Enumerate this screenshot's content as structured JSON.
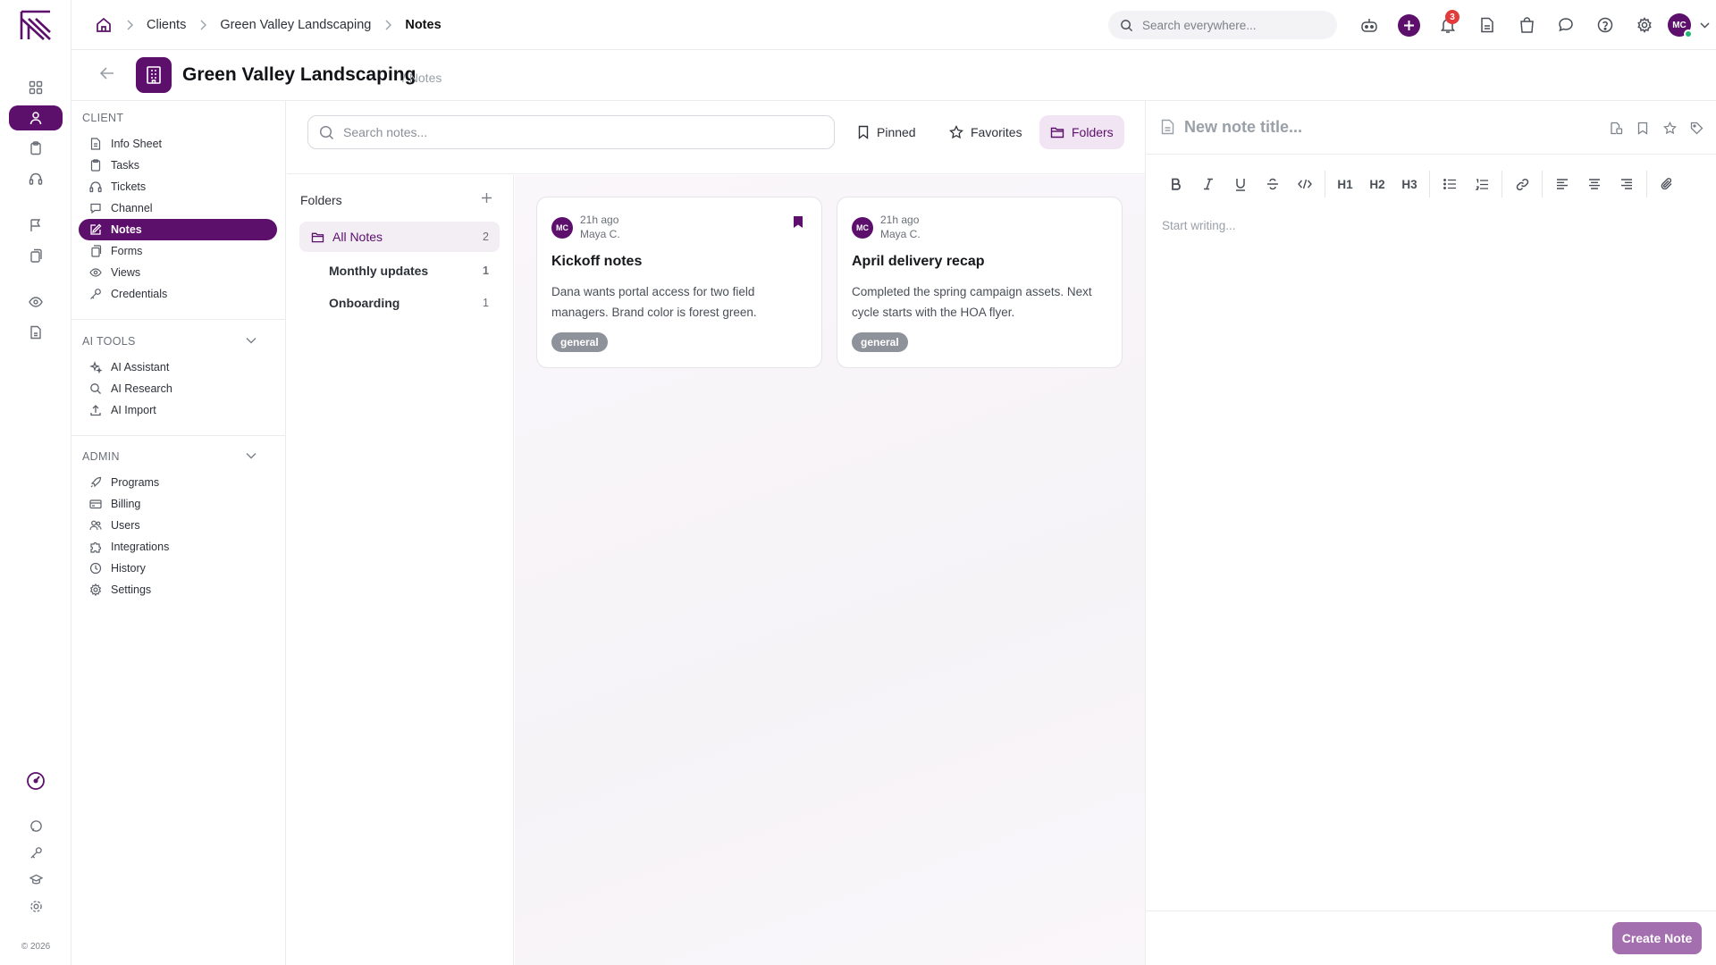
{
  "breadcrumbs": [
    "Clients",
    "Green Valley Landscaping",
    "Notes"
  ],
  "global_search": {
    "placeholder": "Search everywhere..."
  },
  "notifications": {
    "count": "3"
  },
  "user": {
    "initials": "MC"
  },
  "page": {
    "title": "Green Valley Landscaping",
    "subtitle": "/ Notes"
  },
  "nav": {
    "client": {
      "title": "CLIENT",
      "items": [
        {
          "label": "Info Sheet",
          "icon": "info-sheet-icon"
        },
        {
          "label": "Tasks",
          "icon": "clipboard-icon"
        },
        {
          "label": "Tickets",
          "icon": "headset-icon"
        },
        {
          "label": "Channel",
          "icon": "chat-icon"
        },
        {
          "label": "Notes",
          "icon": "edit-icon",
          "active": true
        },
        {
          "label": "Forms",
          "icon": "forms-icon"
        },
        {
          "label": "Views",
          "icon": "eye-icon"
        },
        {
          "label": "Credentials",
          "icon": "key-icon"
        }
      ]
    },
    "ai_tools": {
      "title": "AI TOOLS",
      "items": [
        {
          "label": "AI Assistant",
          "icon": "sparkle-icon"
        },
        {
          "label": "AI Research",
          "icon": "search-icon"
        },
        {
          "label": "AI Import",
          "icon": "upload-icon"
        }
      ]
    },
    "admin": {
      "title": "ADMIN",
      "items": [
        {
          "label": "Programs",
          "icon": "rocket-icon"
        },
        {
          "label": "Billing",
          "icon": "credit-card-icon"
        },
        {
          "label": "Users",
          "icon": "users-icon"
        },
        {
          "label": "Integrations",
          "icon": "puzzle-icon"
        },
        {
          "label": "History",
          "icon": "clock-icon"
        },
        {
          "label": "Settings",
          "icon": "gear-icon"
        }
      ]
    }
  },
  "notes_toolbar": {
    "search_placeholder": "Search notes...",
    "pinned_label": "Pinned",
    "favorites_label": "Favorites",
    "folders_label": "Folders"
  },
  "folders": {
    "title": "Folders",
    "items": [
      {
        "label": "All Notes",
        "count": "2",
        "active": true
      },
      {
        "label": "Monthly updates",
        "count": "1"
      },
      {
        "label": "Onboarding",
        "count": "1"
      }
    ]
  },
  "notes": [
    {
      "avatar": "MC",
      "time": "21h ago",
      "author": "Maya C.",
      "title": "Kickoff notes",
      "body": "Dana wants portal access for two field managers. Brand color is forest green.",
      "tag": "general",
      "pinned": true
    },
    {
      "avatar": "MC",
      "time": "21h ago",
      "author": "Maya C.",
      "title": "April delivery recap",
      "body": "Completed the spring campaign assets. Next cycle starts with the HOA flyer.",
      "tag": "general",
      "pinned": false
    }
  ],
  "editor": {
    "title_placeholder": "New note title...",
    "body_placeholder": "Start writing...",
    "format_labels": {
      "h1": "H1",
      "h2": "H2",
      "h3": "H3"
    },
    "create_label": "Create Note"
  },
  "footer": {
    "copyright": "© 2026"
  },
  "colors": {
    "brand": "#5c0f6b",
    "badge": "#e23b3b",
    "online": "#22b573",
    "tag": "#8e939b"
  }
}
